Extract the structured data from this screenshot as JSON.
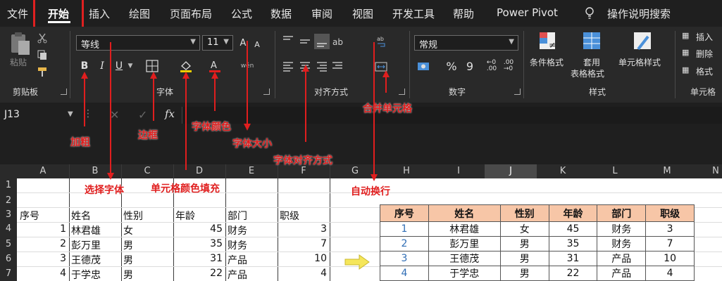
{
  "menu": {
    "tabs": [
      "文件",
      "开始",
      "插入",
      "绘图",
      "页面布局",
      "公式",
      "数据",
      "审阅",
      "视图",
      "开发工具",
      "帮助",
      "Power Pivot"
    ],
    "search": "操作说明搜索"
  },
  "ribbon": {
    "groups": {
      "clipboard": "剪贴板",
      "font": "字体",
      "alignment": "对齐方式",
      "number": "数字",
      "styles": "样式",
      "cells": "单元格"
    },
    "paste_label": "粘贴",
    "font_name": "等线",
    "font_size": "11",
    "bold": "B",
    "italic": "I",
    "underline": "U",
    "number_format": "常规",
    "percent": "%",
    "comma": "9",
    "cond_format": "条件格式",
    "format_table_1": "套用",
    "format_table_2": "表格格式",
    "cell_styles": "单元格样式",
    "insert": "插入",
    "delete": "删除",
    "format": "格式"
  },
  "formula_bar": {
    "name_box": "J13",
    "fx": "fx"
  },
  "annotations": {
    "bold": "加粗",
    "border": "边框",
    "font_color": "字体颜色",
    "font_size": "字体大小",
    "align": "字体对齐方式",
    "merge": "合并单元格",
    "choose_font": "选择字体",
    "fill": "单元格颜色填充",
    "wrap": "自动换行"
  },
  "grid": {
    "columns": [
      "A",
      "B",
      "C",
      "D",
      "E",
      "F",
      "G",
      "H",
      "I",
      "J",
      "K",
      "L",
      "M",
      "N"
    ],
    "rows": [
      "1",
      "2",
      "3",
      "4",
      "5",
      "6",
      "7"
    ],
    "headers": [
      "序号",
      "姓名",
      "性别",
      "年龄",
      "部门",
      "职级"
    ],
    "data": [
      [
        "1",
        "林君雄",
        "女",
        "45",
        "财务",
        "3"
      ],
      [
        "2",
        "彭万里",
        "男",
        "35",
        "财务",
        "7"
      ],
      [
        "3",
        "王德茂",
        "男",
        "31",
        "产品",
        "10"
      ],
      [
        "4",
        "于学忠",
        "男",
        "22",
        "产品",
        "4"
      ]
    ]
  },
  "colors": {
    "accent_red": "#e01e1e",
    "header_fill": "#f7c6a7",
    "index_blue": "#2f6db5"
  }
}
